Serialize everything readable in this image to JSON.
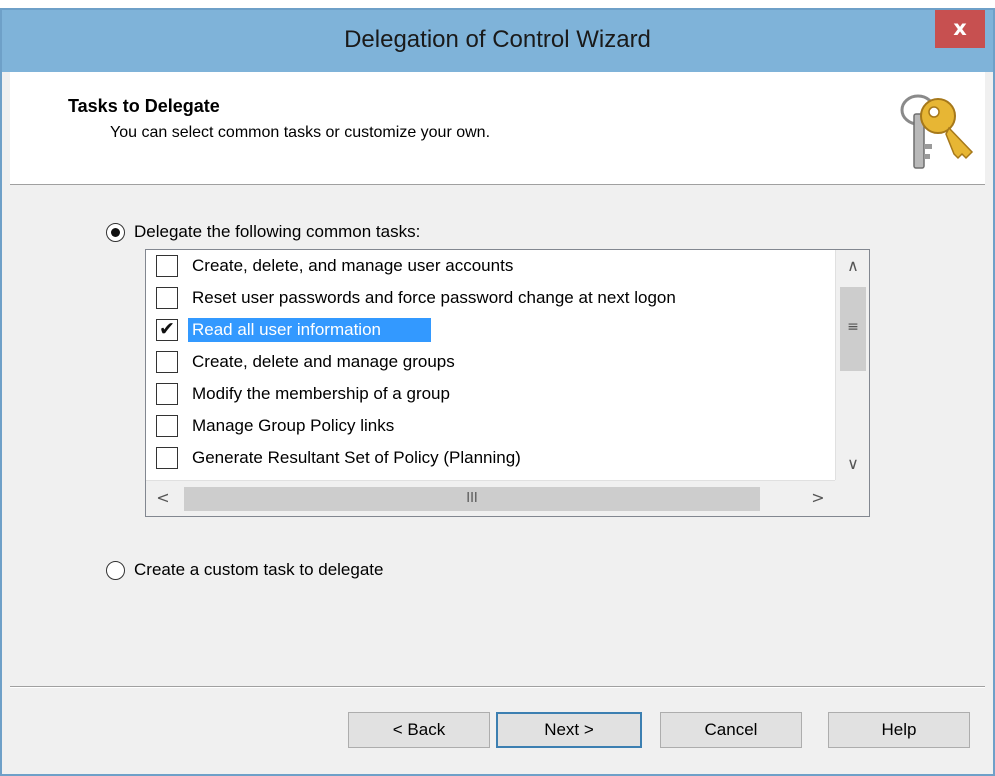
{
  "window": {
    "title": "Delegation of Control Wizard",
    "close_label": "x"
  },
  "header": {
    "title": "Tasks to Delegate",
    "subtitle": "You can select common tasks or customize your own.",
    "icon": "keys-icon"
  },
  "options": {
    "common_tasks": {
      "label": "Delegate the following common tasks:",
      "selected": true
    },
    "custom_task": {
      "label": "Create a custom task to delegate",
      "selected": false
    }
  },
  "tasks": [
    {
      "label": "Create, delete, and manage user accounts",
      "checked": false,
      "selected": false
    },
    {
      "label": "Reset user passwords and force password change at next logon",
      "checked": false,
      "selected": false
    },
    {
      "label": "Read all user information",
      "checked": true,
      "selected": true
    },
    {
      "label": "Create, delete and manage groups",
      "checked": false,
      "selected": false
    },
    {
      "label": "Modify the membership of a group",
      "checked": false,
      "selected": false
    },
    {
      "label": "Manage Group Policy links",
      "checked": false,
      "selected": false
    },
    {
      "label": "Generate Resultant Set of Policy (Planning)",
      "checked": false,
      "selected": false
    }
  ],
  "scrollbars": {
    "up": "∧",
    "down": "∨",
    "left": "<",
    "right": ">",
    "v_grip": "≡",
    "h_grip": "III"
  },
  "buttons": {
    "back": "< Back",
    "next": "Next >",
    "cancel": "Cancel",
    "help": "Help"
  },
  "colors": {
    "titlebar": "#7fb3d9",
    "close": "#c75050",
    "selection": "#3399ff"
  }
}
